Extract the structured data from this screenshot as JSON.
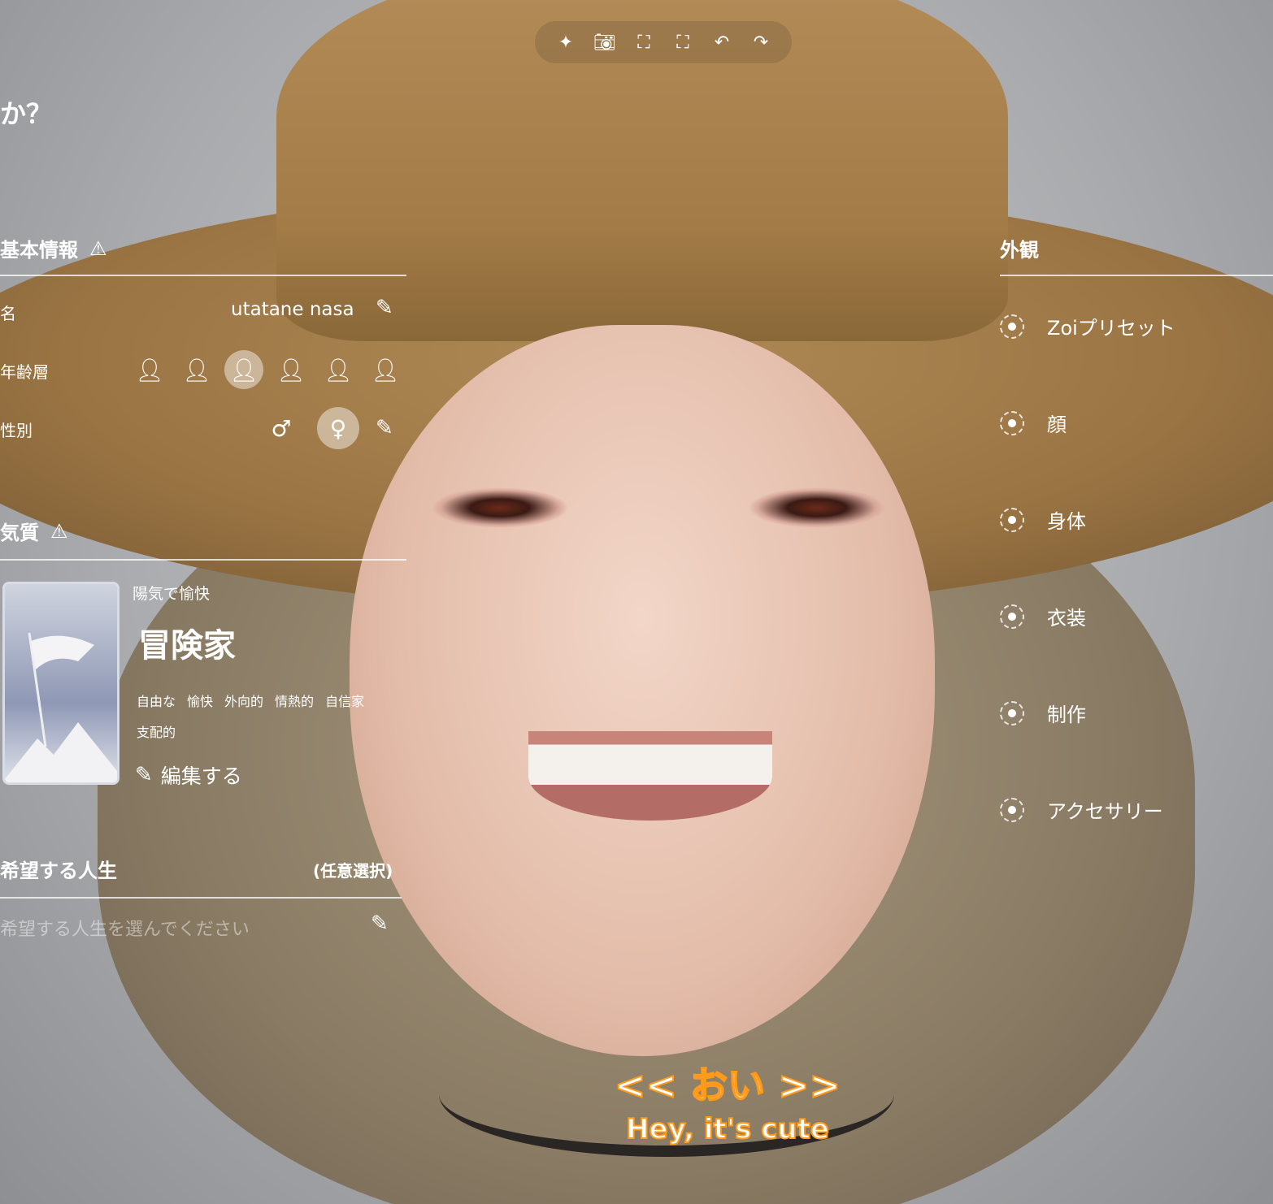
{
  "toolbar": {
    "icons": [
      "sparkle-icon",
      "camera-icon",
      "face-scan-icon",
      "body-scan-icon",
      "undo-icon",
      "redo-icon"
    ]
  },
  "header": {
    "question_fragment": "か？"
  },
  "basic_info": {
    "title": "基本情報",
    "name_label": "名",
    "name_value": "utatane nasa",
    "age_label": "年齢層",
    "age_options": [
      "baby",
      "child",
      "teen",
      "young-adult",
      "adult",
      "elder"
    ],
    "age_selected": "teen",
    "gender_label": "性別",
    "gender_options": [
      "♂",
      "♀"
    ],
    "gender_selected": "♀"
  },
  "temperament": {
    "title": "気質",
    "subtitle": "陽気で愉快",
    "type": "冒険家",
    "traits": [
      "自由な",
      "愉快",
      "外向的",
      "情熱的",
      "自信家",
      "支配的"
    ],
    "edit_label": "編集する"
  },
  "life_goal": {
    "title": "希望する人生",
    "optional": "(任意選択)",
    "placeholder": "希望する人生を選んでください"
  },
  "appearance": {
    "title": "外観",
    "items": [
      "Zoiプリセット",
      "顔",
      "身体",
      "衣装",
      "制作",
      "アクセサリー"
    ]
  },
  "subtitle": {
    "jp": "<< おい >>",
    "en": "Hey, it's cute"
  },
  "colors": {
    "subtitle_outline": "#ff9a1a",
    "hat": "#a27b47"
  }
}
